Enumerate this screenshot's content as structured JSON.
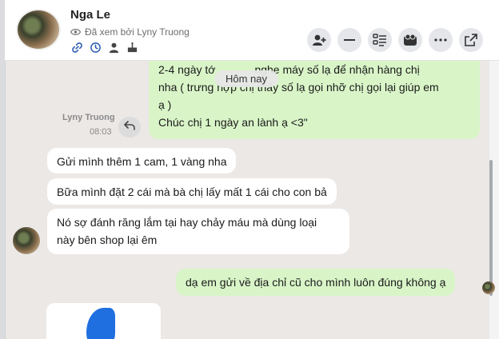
{
  "header": {
    "contact_name": "Nga Le",
    "seen_by": "Đã xem bởi Lyny Truong",
    "tool_icons": [
      "link-icon",
      "history-icon",
      "user-icon",
      "cake-icon"
    ],
    "action_buttons": [
      "add-user-icon",
      "minimize-icon",
      "contact-card-icon",
      "contacts-icon",
      "more-icon",
      "popout-icon"
    ]
  },
  "date_divider": "Hôm nay",
  "top_message": {
    "line1": "2-4 ngày tới khi bên c nghe máy số lạ để nhận hàng chị",
    "line1_visible_left": "2-4 ngày tớ",
    "line1_visible_right": "nghe máy số lạ để nhận hàng chị",
    "line2": "nha ( trường hợp chị thấy số lạ gọi nhỡ chị gọi lại giúp em",
    "line2_visible_left": "nha ( trư",
    "line2_visible_right": "ng hợp chị thấy số lạ gọi nhỡ chị gọi lại giúp em",
    "line3": "ạ )",
    "line4": "Chúc chị 1 ngày an lành ạ <3\""
  },
  "sender": {
    "name": "Lyny Truong",
    "time": "08:03"
  },
  "messages": [
    {
      "from": "them",
      "text": "Gửi mình thêm 1 cam, 1 vàng nha"
    },
    {
      "from": "them",
      "text": "Bữa mình đặt 2 cái mà bà chị lấy mất 1 cái cho con bả"
    },
    {
      "from": "them",
      "text_line1": "Nó sợ đánh răng lắm tại hay chảy máu mà dùng loại",
      "text_line2": "này bên shop lại êm"
    },
    {
      "from": "me",
      "text": "dạ em gửi về địa chỉ cũ cho mình luôn đúng không ạ"
    }
  ],
  "colors": {
    "my_bubble": "#d9f5c8",
    "their_bubble": "#ffffff",
    "chat_bg": "#ebe8e6",
    "image_accent": "#1f6fe0"
  }
}
